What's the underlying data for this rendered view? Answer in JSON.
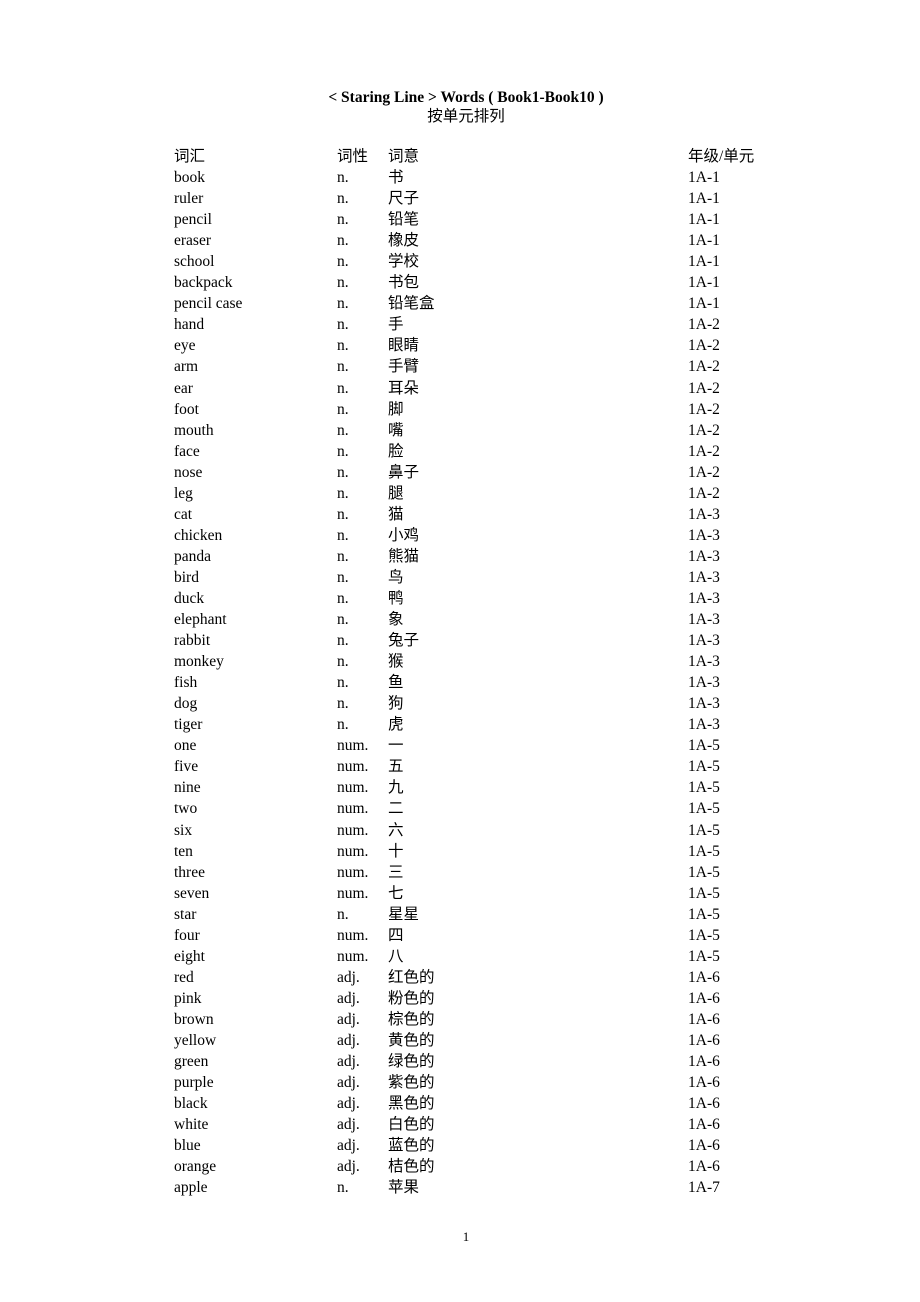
{
  "document": {
    "title": "< Staring Line > Words ( Book1-Book10 )",
    "subtitle": "按单元排列",
    "page_number": "1"
  },
  "table": {
    "headers": [
      "词汇",
      "词性",
      "词意",
      "年级/单元"
    ],
    "rows": [
      {
        "word": "book",
        "pos": "n.",
        "meaning": "书",
        "unit": "1A-1"
      },
      {
        "word": "ruler",
        "pos": "n.",
        "meaning": "尺子",
        "unit": "1A-1"
      },
      {
        "word": "pencil",
        "pos": "n.",
        "meaning": "铅笔",
        "unit": "1A-1"
      },
      {
        "word": "eraser",
        "pos": "n.",
        "meaning": "橡皮",
        "unit": "1A-1"
      },
      {
        "word": "school",
        "pos": "n.",
        "meaning": "学校",
        "unit": "1A-1"
      },
      {
        "word": "backpack",
        "pos": "n.",
        "meaning": "书包",
        "unit": "1A-1"
      },
      {
        "word": "pencil case",
        "pos": "n.",
        "meaning": "铅笔盒",
        "unit": "1A-1"
      },
      {
        "word": "hand",
        "pos": "n.",
        "meaning": "手",
        "unit": "1A-2"
      },
      {
        "word": "eye",
        "pos": "n.",
        "meaning": "眼睛",
        "unit": "1A-2"
      },
      {
        "word": "arm",
        "pos": "n.",
        "meaning": "手臂",
        "unit": "1A-2"
      },
      {
        "word": "ear",
        "pos": "n.",
        "meaning": "耳朵",
        "unit": "1A-2"
      },
      {
        "word": "foot",
        "pos": "n.",
        "meaning": "脚",
        "unit": "1A-2"
      },
      {
        "word": "mouth",
        "pos": "n.",
        "meaning": "嘴",
        "unit": "1A-2"
      },
      {
        "word": "face",
        "pos": "n.",
        "meaning": "脸",
        "unit": "1A-2"
      },
      {
        "word": "nose",
        "pos": "n.",
        "meaning": "鼻子",
        "unit": "1A-2"
      },
      {
        "word": "leg",
        "pos": "n.",
        "meaning": "腿",
        "unit": "1A-2"
      },
      {
        "word": "cat",
        "pos": "n.",
        "meaning": "猫",
        "unit": "1A-3"
      },
      {
        "word": "chicken",
        "pos": "n.",
        "meaning": "小鸡",
        "unit": "1A-3"
      },
      {
        "word": "panda",
        "pos": "n.",
        "meaning": "熊猫",
        "unit": "1A-3"
      },
      {
        "word": "bird",
        "pos": "n.",
        "meaning": "鸟",
        "unit": "1A-3"
      },
      {
        "word": "duck",
        "pos": "n.",
        "meaning": "鸭",
        "unit": "1A-3"
      },
      {
        "word": "elephant",
        "pos": "n.",
        "meaning": "象",
        "unit": "1A-3"
      },
      {
        "word": "rabbit",
        "pos": "n.",
        "meaning": "兔子",
        "unit": "1A-3"
      },
      {
        "word": "monkey",
        "pos": "n.",
        "meaning": "猴",
        "unit": "1A-3"
      },
      {
        "word": "fish",
        "pos": "n.",
        "meaning": "鱼",
        "unit": "1A-3"
      },
      {
        "word": "dog",
        "pos": "n.",
        "meaning": "狗",
        "unit": "1A-3"
      },
      {
        "word": "tiger",
        "pos": "n.",
        "meaning": "虎",
        "unit": "1A-3"
      },
      {
        "word": "one",
        "pos": "num.",
        "meaning": "一",
        "unit": "1A-5"
      },
      {
        "word": "five",
        "pos": "num.",
        "meaning": "五",
        "unit": "1A-5"
      },
      {
        "word": "nine",
        "pos": "num.",
        "meaning": "九",
        "unit": "1A-5"
      },
      {
        "word": "two",
        "pos": "num.",
        "meaning": "二",
        "unit": "1A-5"
      },
      {
        "word": "six",
        "pos": "num.",
        "meaning": "六",
        "unit": "1A-5"
      },
      {
        "word": "ten",
        "pos": "num.",
        "meaning": "十",
        "unit": "1A-5"
      },
      {
        "word": "three",
        "pos": "num.",
        "meaning": "三",
        "unit": "1A-5"
      },
      {
        "word": "seven",
        "pos": "num.",
        "meaning": "七",
        "unit": "1A-5"
      },
      {
        "word": "star",
        "pos": "n.",
        "meaning": "星星",
        "unit": "1A-5"
      },
      {
        "word": "four",
        "pos": "num.",
        "meaning": "四",
        "unit": "1A-5"
      },
      {
        "word": "eight",
        "pos": "num.",
        "meaning": "八",
        "unit": "1A-5"
      },
      {
        "word": "red",
        "pos": "adj.",
        "meaning": "红色的",
        "unit": "1A-6"
      },
      {
        "word": "pink",
        "pos": "adj.",
        "meaning": "粉色的",
        "unit": "1A-6"
      },
      {
        "word": "brown",
        "pos": "adj.",
        "meaning": "棕色的",
        "unit": "1A-6"
      },
      {
        "word": "yellow",
        "pos": "adj.",
        "meaning": "黄色的",
        "unit": "1A-6"
      },
      {
        "word": "green",
        "pos": "adj.",
        "meaning": "绿色的",
        "unit": "1A-6"
      },
      {
        "word": "purple",
        "pos": "adj.",
        "meaning": "紫色的",
        "unit": "1A-6"
      },
      {
        "word": "black",
        "pos": "adj.",
        "meaning": "黑色的",
        "unit": "1A-6"
      },
      {
        "word": "white",
        "pos": "adj.",
        "meaning": "白色的",
        "unit": "1A-6"
      },
      {
        "word": "blue",
        "pos": "adj.",
        "meaning": "蓝色的",
        "unit": "1A-6"
      },
      {
        "word": "orange",
        "pos": "adj.",
        "meaning": "桔色的",
        "unit": "1A-6"
      },
      {
        "word": "apple",
        "pos": "n.",
        "meaning": "苹果",
        "unit": "1A-7"
      }
    ]
  }
}
